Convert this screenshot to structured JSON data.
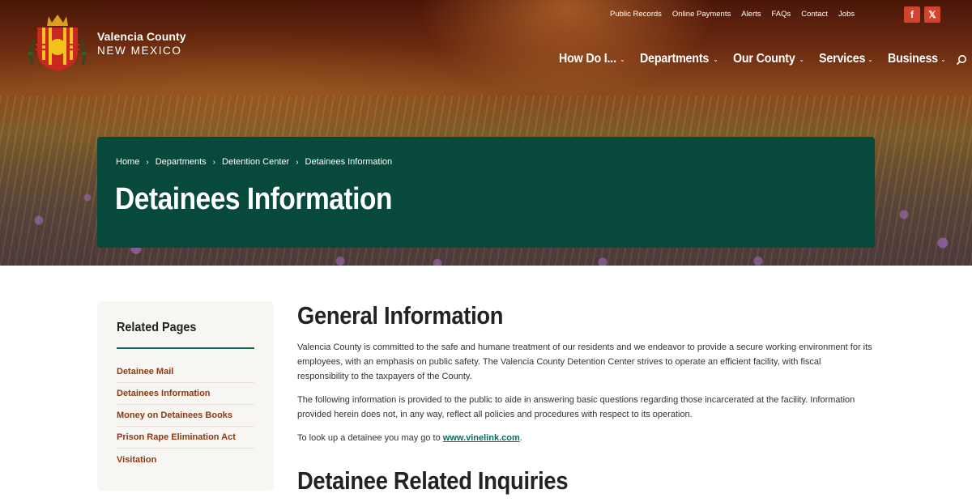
{
  "site": {
    "name": "Valencia County",
    "state": "NEW MEXICO"
  },
  "utility_nav": [
    "Public Records",
    "Online Payments",
    "Alerts",
    "FAQs",
    "Contact",
    "Jobs"
  ],
  "social": [
    {
      "icon": "facebook-icon",
      "glyph": "f"
    },
    {
      "icon": "x-icon",
      "glyph": "𝕏"
    }
  ],
  "main_nav": [
    "How Do I...",
    "Departments",
    "Our County",
    "Services",
    "Business"
  ],
  "breadcrumb": [
    "Home",
    "Departments",
    "Detention Center",
    "Detainees Information"
  ],
  "page_title": "Detainees Information",
  "sidebar": {
    "title": "Related Pages",
    "items": [
      "Detainee Mail",
      "Detainees Information",
      "Money on Detainees Books",
      "Prison Rape Elimination Act",
      "Visitation"
    ]
  },
  "content": {
    "heading": "General Information",
    "paragraph1": "Valencia County is committed to the safe and humane treatment of our residents and we endeavor to provide a secure working environment for its employees, with an emphasis on public safety. The Valencia County Detention Center strives to operate an efficient facility, with fiscal responsibility to the taxpayers of the County.",
    "paragraph2": "The following information is provided to the public to aide in answering basic questions regarding those incarcerated at the facility. Information provided herein does not, in any way, reflect all policies and procedures with respect to its operation.",
    "paragraph3_prefix": "To look up a detainee you may go to ",
    "paragraph3_link": "www.vinelink.com",
    "paragraph3_suffix": ".",
    "heading2": "Detainee Related Inquiries"
  },
  "colors": {
    "banner": "#074a3c",
    "sidebar_link": "#8b3a12",
    "accent_rule": "#0d6a5a",
    "social": "#d2452c"
  }
}
